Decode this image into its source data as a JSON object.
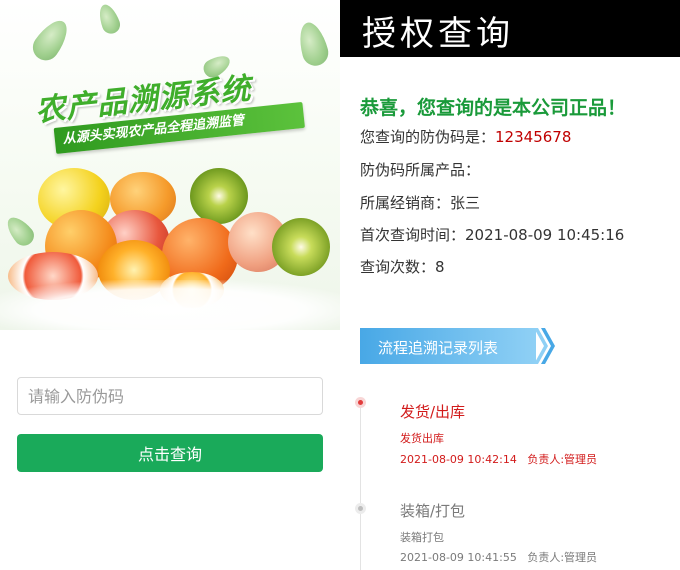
{
  "banner": {
    "title": "农产品溯源系统",
    "slogan": "从源头实现农产品全程追溯监管"
  },
  "search": {
    "placeholder": "请输入防伪码",
    "button_label": "点击查询"
  },
  "header": {
    "title": "授权查询"
  },
  "result": {
    "success_message": "恭喜，您查询的是本公司正品！",
    "code_label": "您查询的防伪码是：",
    "code_value": "12345678",
    "product_label": "防伪码所属产品：",
    "product_value": "",
    "dealer_label": "所属经销商：",
    "dealer_value": "张三",
    "first_query_label": "首次查询时间：",
    "first_query_value": "2021-08-09 10:45:16",
    "count_label": "查询次数：",
    "count_value": "8"
  },
  "flow": {
    "section_label": "流程追溯记录列表",
    "events": [
      {
        "title": "发货/出库",
        "detail": "发货出库",
        "time": "2021-08-09 10:42:14",
        "owner": "负责人:管理员",
        "status": "current"
      },
      {
        "title": "装箱/打包",
        "detail": "装箱打包",
        "time": "2021-08-09 10:41:55",
        "owner": "负责人:管理员",
        "status": "past"
      }
    ]
  },
  "colors": {
    "brand_green": "#1aaa5a",
    "success_green": "#1a9a3a",
    "code_red": "#c00000",
    "event_red": "#d21b1b",
    "header_bg": "#000000",
    "flow_blue": "#48a8e6"
  },
  "icons": {
    "flow_arrow": "double-chevron-right-icon",
    "timeline_dot": "timeline-dot-icon"
  }
}
